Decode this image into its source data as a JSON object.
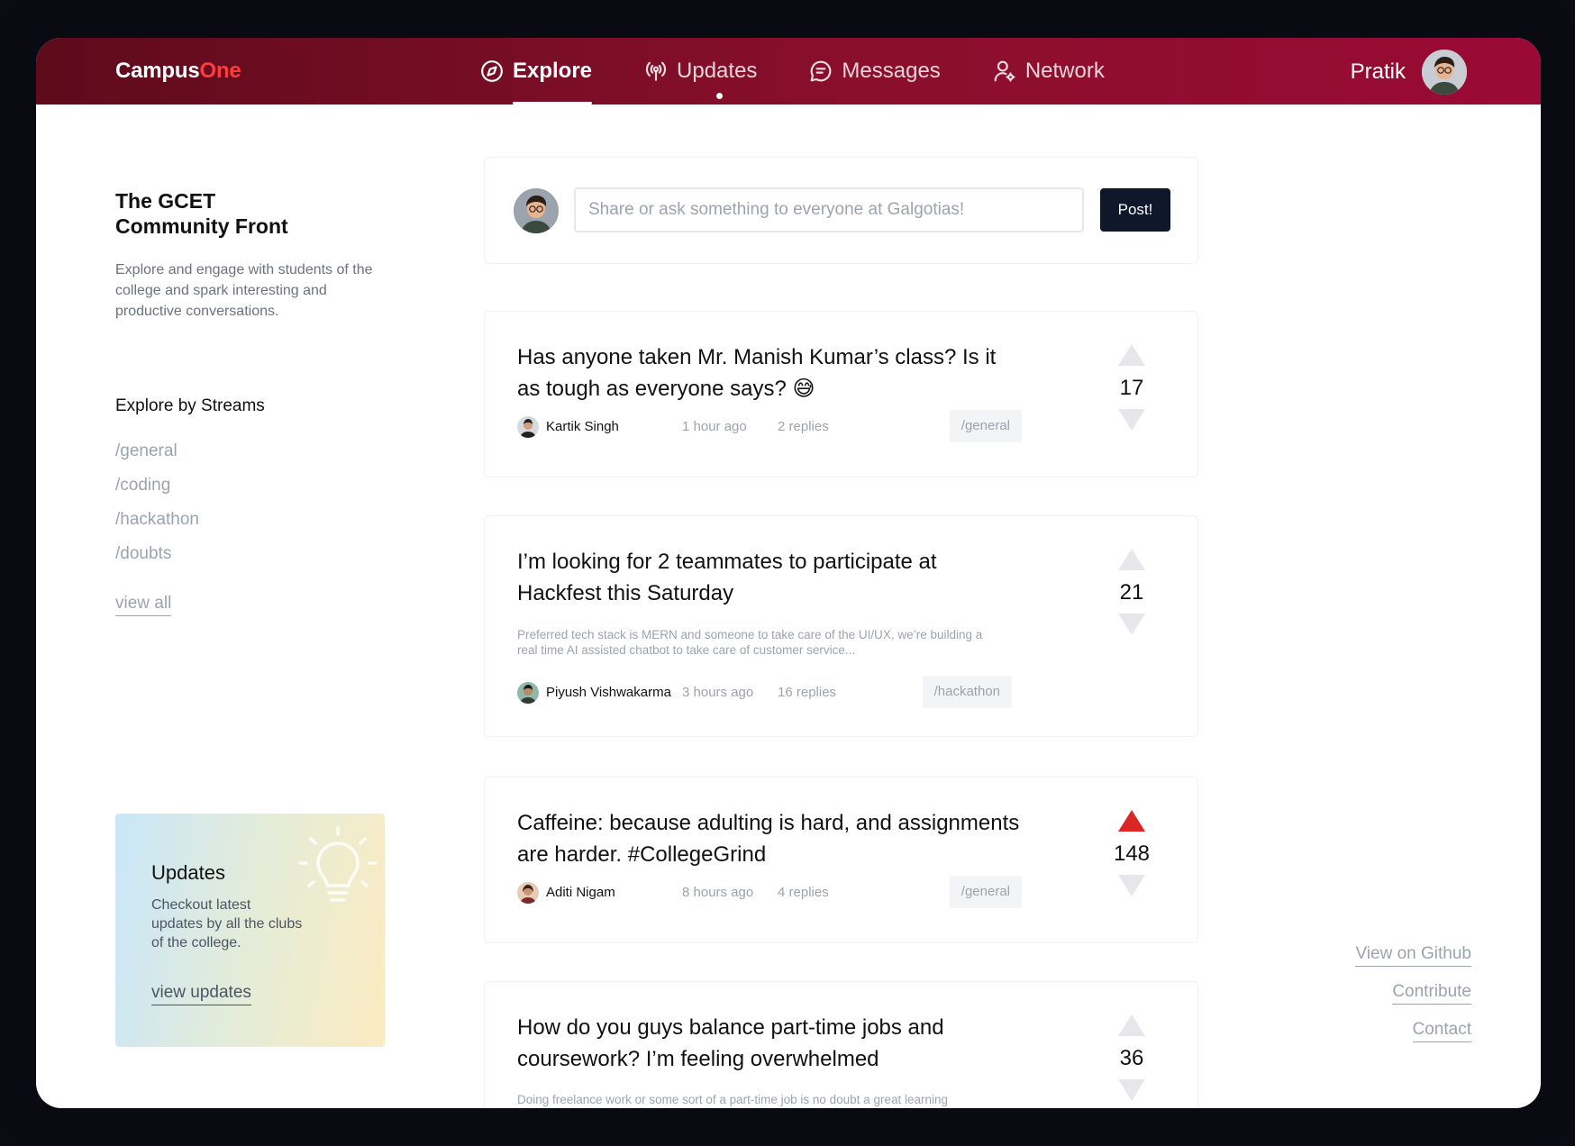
{
  "app": {
    "logo_main": "Campus",
    "logo_accent": "One",
    "brand_color": "#8a0f2c",
    "accent_color": "#ff3b3b"
  },
  "nav": {
    "items": [
      {
        "label": "Explore",
        "icon": "compass-icon",
        "active": true
      },
      {
        "label": "Updates",
        "icon": "broadcast-icon",
        "has_notification": true
      },
      {
        "label": "Messages",
        "icon": "chat-icon"
      },
      {
        "label": "Network",
        "icon": "user-network-icon"
      }
    ],
    "user_name": "Pratik"
  },
  "sidebar": {
    "title": "The GCET\nCommunity Front",
    "description": "Explore and engage with students of the college and spark interesting and productive conversations.",
    "streams_title": "Explore by Streams",
    "streams": [
      "/general",
      "/coding",
      "/hackathon",
      "/doubts"
    ],
    "view_all": "view all",
    "updates_card": {
      "title": "Updates",
      "text": "Checkout latest updates by all the clubs of the college.",
      "link": "view updates",
      "icon": "lightbulb-icon"
    }
  },
  "composer": {
    "placeholder": "Share or ask something to everyone at Galgotias!",
    "button": "Post!"
  },
  "posts": [
    {
      "title": "Has anyone taken Mr. Manish Kumar’s class? Is it as tough as everyone says? 😅",
      "excerpt": "",
      "author": "Kartik Singh",
      "time": "1 hour ago",
      "replies": "2 replies",
      "tag": "/general",
      "votes": "17",
      "upvoted": false
    },
    {
      "title": "I’m looking for 2 teammates to participate at Hackfest this Saturday",
      "excerpt": "Preferred tech stack is MERN and someone to take care of the UI/UX, we’re building a real time AI assisted chatbot to take care of customer service...",
      "author": "Piyush Vishwakarma",
      "time": "3 hours ago",
      "replies": "16 replies",
      "tag": "/hackathon",
      "votes": "21",
      "upvoted": false
    },
    {
      "title": "Caffeine: because adulting is hard, and assignments are harder. #CollegeGrind",
      "excerpt": "",
      "author": "Aditi Nigam",
      "time": "8 hours ago",
      "replies": "4 replies",
      "tag": "/general",
      "votes": "148",
      "upvoted": true
    },
    {
      "title": "How do you guys balance part-time jobs and coursework? I’m feeling overwhelmed",
      "excerpt": "Doing freelance work or some sort of a part-time job is no doubt a great learning",
      "author": "",
      "time": "",
      "replies": "",
      "tag": "",
      "votes": "36",
      "upvoted": false
    }
  ],
  "footer_links": [
    "View on Github",
    "Contribute",
    "Contact"
  ],
  "colors": {
    "upvote_active": "#dc2626",
    "vote_inactive": "#e5e7eb"
  }
}
